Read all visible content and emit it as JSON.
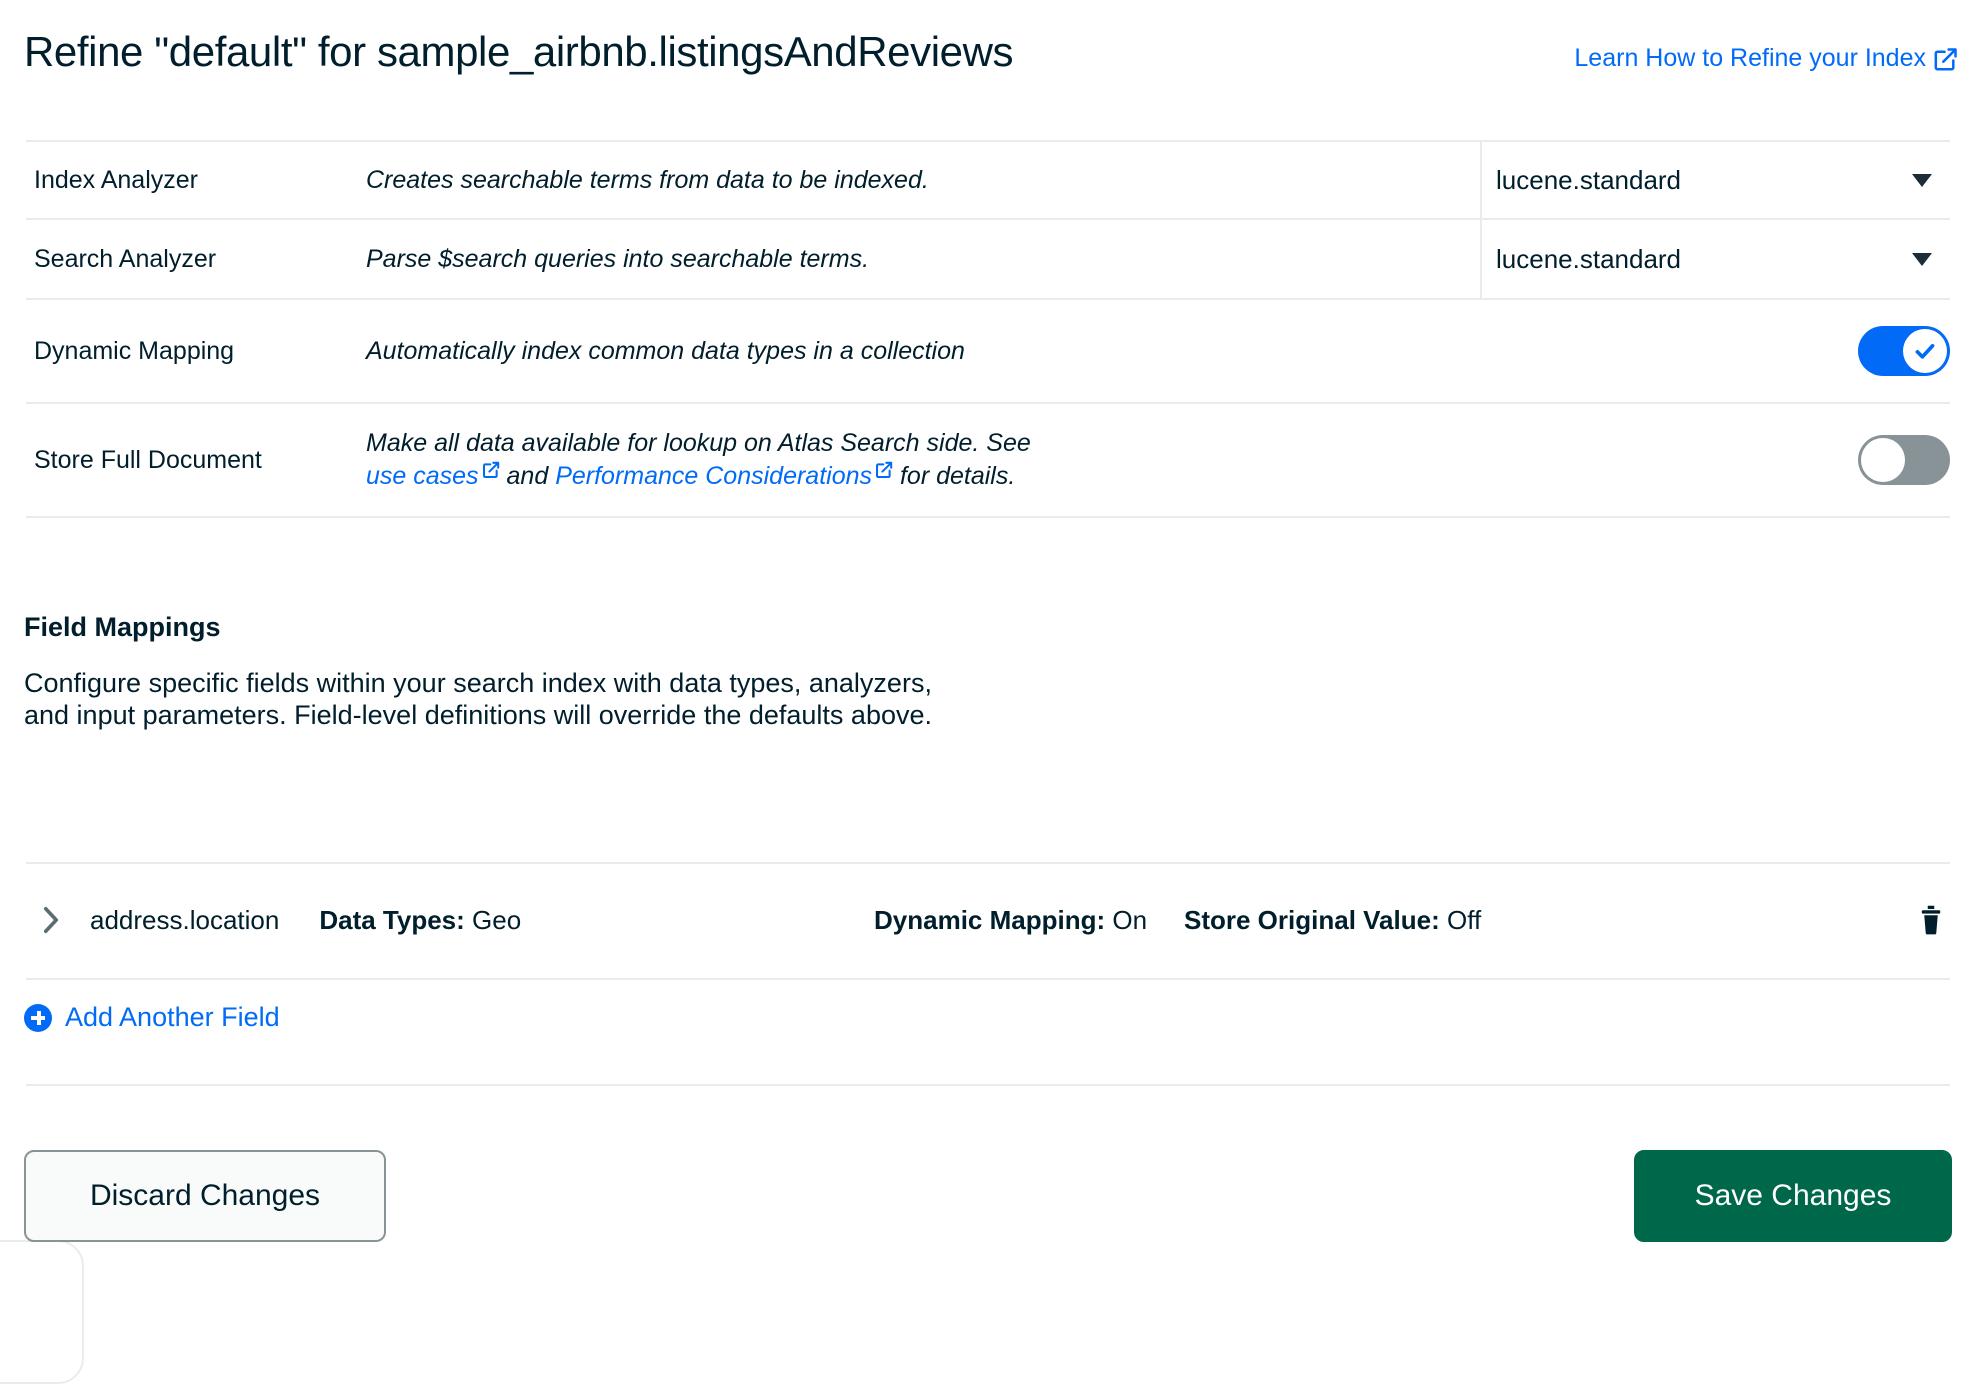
{
  "header": {
    "title": "Refine \"default\" for sample_airbnb.listingsAndReviews",
    "learn_link_label": "Learn How to Refine your Index"
  },
  "settings": {
    "index_analyzer": {
      "label": "Index Analyzer",
      "description": "Creates searchable terms from data to be indexed.",
      "value": "lucene.standard"
    },
    "search_analyzer": {
      "label": "Search Analyzer",
      "description": "Parse $search queries into searchable terms.",
      "value": "lucene.standard"
    },
    "dynamic_mapping": {
      "label": "Dynamic Mapping",
      "description": "Automatically index common data types in a collection",
      "state": "on"
    },
    "store_full_document": {
      "label": "Store Full Document",
      "description_part1": "Make all data available for lookup on Atlas Search side. See",
      "link1": "use cases",
      "description_part2": "and",
      "link2": "Performance Considerations",
      "description_part3": "for details.",
      "state": "off"
    }
  },
  "field_mappings": {
    "title": "Field Mappings",
    "description": "Configure specific fields within your search index with data types, analyzers, and input parameters. Field-level definitions will override the defaults above.",
    "rows": [
      {
        "name": "address.location",
        "data_types_label": "Data Types:",
        "data_types_value": "Geo",
        "dynamic_mapping_label": "Dynamic Mapping:",
        "dynamic_mapping_value": "On",
        "store_original_label": "Store Original Value:",
        "store_original_value": "Off"
      }
    ],
    "add_another_field_label": "Add Another Field"
  },
  "footer": {
    "discard_label": "Discard Changes",
    "save_label": "Save Changes"
  },
  "colors": {
    "accent_blue": "#016BF8",
    "save_green": "#00684A",
    "toggle_off_gray": "#889397",
    "text": "#001E2B",
    "divider": "#E8EDEB"
  }
}
